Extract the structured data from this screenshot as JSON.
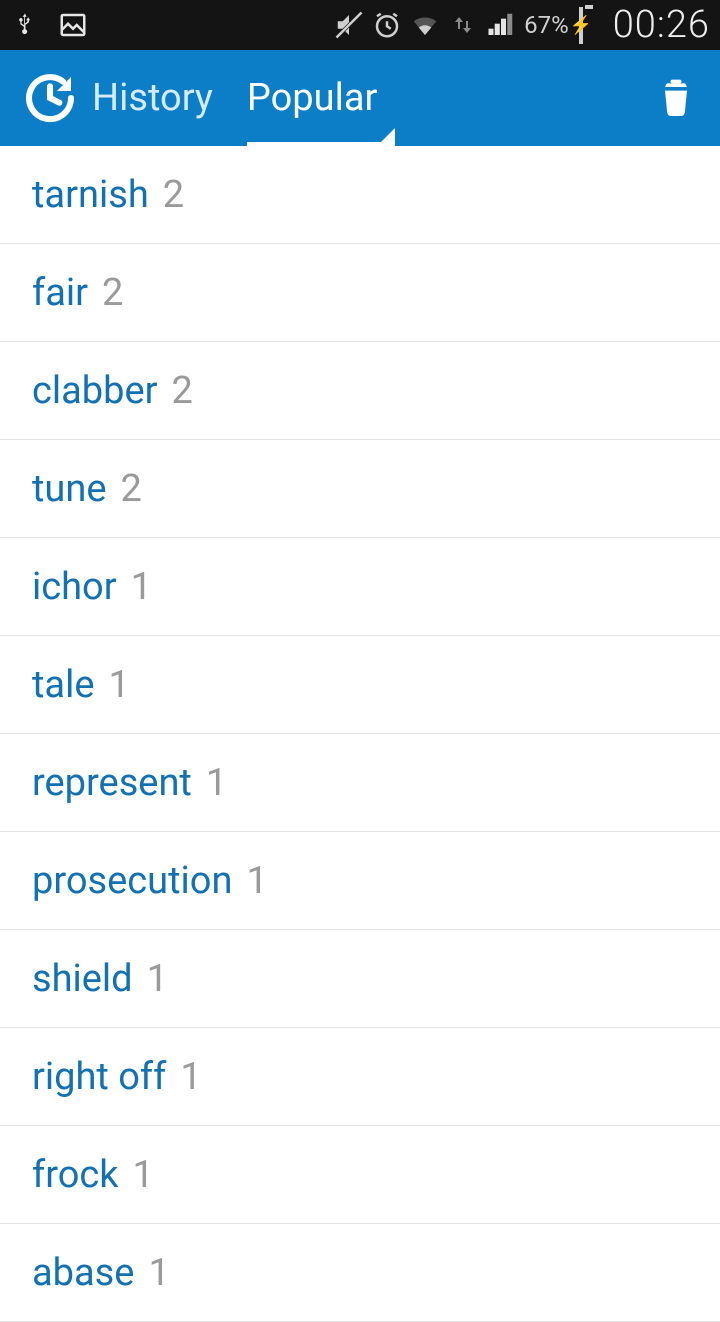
{
  "status_bar": {
    "battery_percent_label": "67%",
    "clock": "00:26"
  },
  "app_bar": {
    "tabs": {
      "history_label": "History",
      "popular_label": "Popular",
      "active": "popular"
    }
  },
  "list": {
    "items": [
      {
        "word": "tarnish",
        "count": "2"
      },
      {
        "word": "fair",
        "count": "2"
      },
      {
        "word": "clabber",
        "count": "2"
      },
      {
        "word": "tune",
        "count": "2"
      },
      {
        "word": "ichor",
        "count": "1"
      },
      {
        "word": "tale",
        "count": "1"
      },
      {
        "word": "represent",
        "count": "1"
      },
      {
        "word": "prosecution",
        "count": "1"
      },
      {
        "word": "shield",
        "count": "1"
      },
      {
        "word": "right off",
        "count": "1"
      },
      {
        "word": "frock",
        "count": "1"
      },
      {
        "word": "abase",
        "count": "1"
      }
    ]
  }
}
